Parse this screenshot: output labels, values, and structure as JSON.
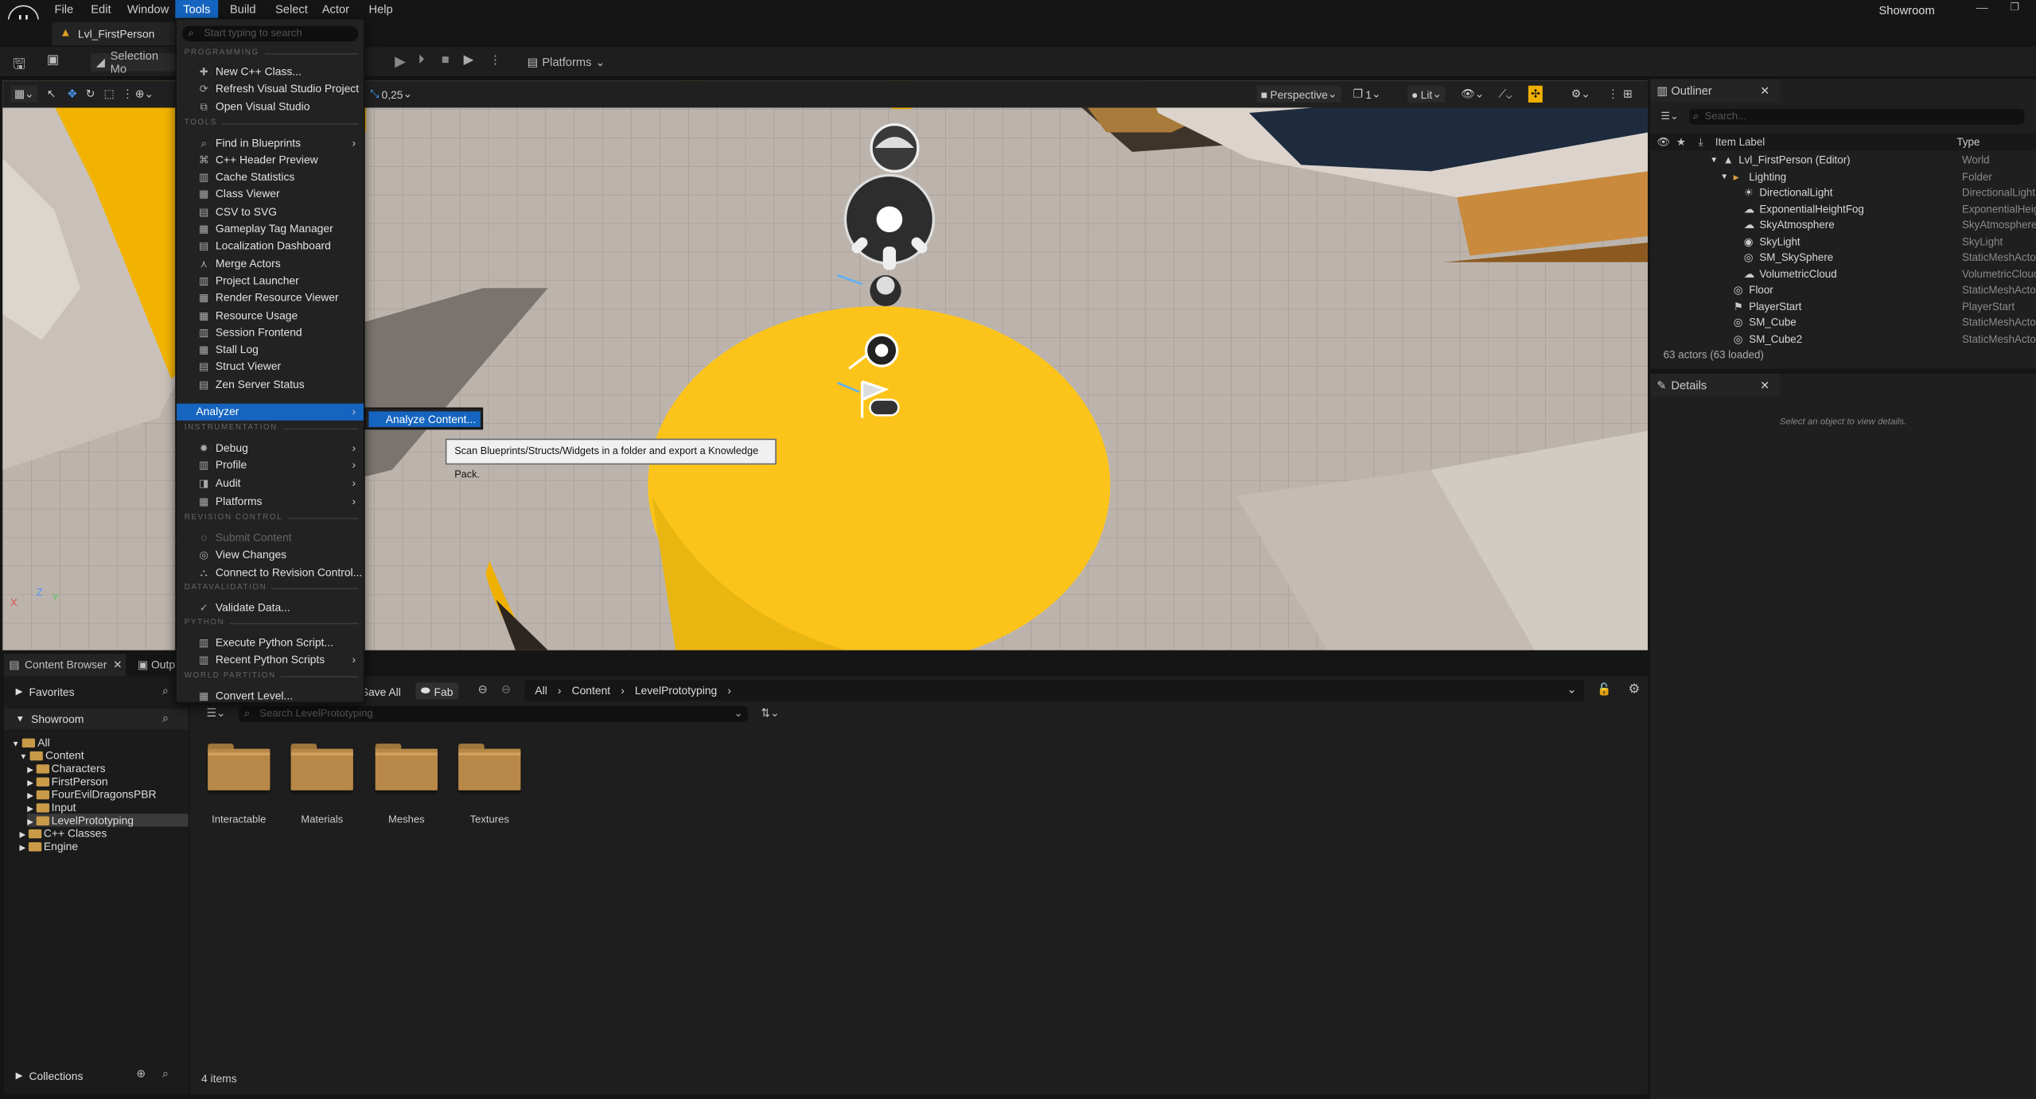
{
  "app": {
    "level_name": "Lvl_FirstPerson",
    "project": "Showroom"
  },
  "menubar": [
    "File",
    "Edit",
    "Window",
    "Tools",
    "Build",
    "Select",
    "Actor",
    "Help"
  ],
  "toolbar": {
    "selection_mode": "Selection Mo",
    "platforms": "Platforms"
  },
  "viewport": {
    "snap_value": "0,25",
    "perspective": "Perspective",
    "camera_speed": "1",
    "lit": "Lit",
    "axis_x": "X",
    "axis_y": "Y",
    "axis_z": "Z"
  },
  "tools_menu": {
    "search_placeholder": "Start typing to search",
    "sections": {
      "programming": "PROGRAMMING",
      "tools": "TOOLS",
      "instrumentation": "INSTRUMENTATION",
      "revision_control": "REVISION CONTROL",
      "datavalidation": "DATAVALIDATION",
      "python": "PYTHON",
      "world_partition": "WORLD PARTITION"
    },
    "programming": [
      "New C++ Class...",
      "Refresh Visual Studio Project",
      "Open Visual Studio"
    ],
    "tools": [
      "Find in Blueprints",
      "C++ Header Preview",
      "Cache Statistics",
      "Class Viewer",
      "CSV to SVG",
      "Gameplay Tag Manager",
      "Localization Dashboard",
      "Merge Actors",
      "Project Launcher",
      "Render Resource Viewer",
      "Resource Usage",
      "Session Frontend",
      "Stall Log",
      "Struct Viewer",
      "Zen Server Status"
    ],
    "analyzer": "Analyzer",
    "instrumentation": [
      "Debug",
      "Profile",
      "Audit",
      "Platforms"
    ],
    "revision_control": [
      "Submit Content",
      "View Changes",
      "Connect to Revision Control..."
    ],
    "datavalidation": [
      "Validate Data..."
    ],
    "python": [
      "Execute Python Script...",
      "Recent Python Scripts"
    ],
    "world_partition": [
      "Convert Level..."
    ]
  },
  "submenu": {
    "analyze_content": "Analyze Content..."
  },
  "tooltip": "Scan Blueprints/Structs/Widgets in a folder and export a Knowledge Pack.",
  "outliner": {
    "title": "Outliner",
    "search_placeholder": "Search...",
    "col_label": "Item Label",
    "col_type": "Type",
    "rows": [
      {
        "label": "Lvl_FirstPerson (Editor)",
        "type": "World"
      },
      {
        "label": "Lighting",
        "type": "Folder"
      },
      {
        "label": "DirectionalLight",
        "type": "DirectionalLight"
      },
      {
        "label": "ExponentialHeightFog",
        "type": "ExponentialHeightFog"
      },
      {
        "label": "SkyAtmosphere",
        "type": "SkyAtmosphere"
      },
      {
        "label": "SkyLight",
        "type": "SkyLight"
      },
      {
        "label": "SM_SkySphere",
        "type": "StaticMeshActor"
      },
      {
        "label": "VolumetricCloud",
        "type": "VolumetricCloud"
      },
      {
        "label": "Floor",
        "type": "StaticMeshActor"
      },
      {
        "label": "PlayerStart",
        "type": "PlayerStart"
      },
      {
        "label": "SM_Cube",
        "type": "StaticMeshActor"
      },
      {
        "label": "SM_Cube2",
        "type": "StaticMeshActor"
      }
    ],
    "footer": "63 actors (63 loaded)"
  },
  "details": {
    "title": "Details",
    "empty": "Select an object to view details."
  },
  "content_browser": {
    "tab": "Content Browser",
    "tab2": "Outp",
    "favorites": "Favorites",
    "project": "Showroom",
    "collections": "Collections",
    "save_all": "Save All",
    "fab": "Fab",
    "breadcrumb": [
      "All",
      "Content",
      "LevelPrototyping"
    ],
    "search_placeholder": "Search LevelPrototyping",
    "tree": [
      "All",
      "Content",
      "Characters",
      "FirstPerson",
      "FourEvilDragonsPBR",
      "Input",
      "LevelPrototyping",
      "C++ Classes",
      "Engine"
    ],
    "folders": [
      "Interactable",
      "Materials",
      "Meshes",
      "Textures"
    ],
    "count": "4 items"
  }
}
